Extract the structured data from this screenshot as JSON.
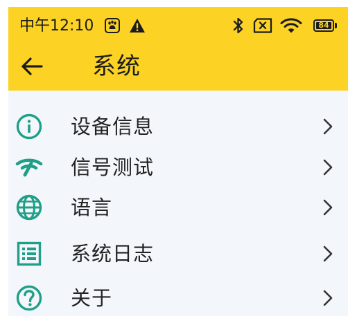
{
  "status_bar": {
    "time": "中午12:10",
    "battery_level": "84",
    "icons": [
      "baidu-paw-icon",
      "warning-icon",
      "bluetooth-icon",
      "no-sim-icon",
      "wifi-icon",
      "battery-icon"
    ]
  },
  "header": {
    "back_icon": "arrow-left-icon",
    "title": "系统"
  },
  "menu": {
    "items": [
      {
        "label": "设备信息",
        "icon": "info-icon"
      },
      {
        "label": "信号测试",
        "icon": "signal-icon"
      },
      {
        "label": "语言",
        "icon": "globe-icon"
      },
      {
        "label": "系统日志",
        "icon": "list-log-icon"
      },
      {
        "label": "关于",
        "icon": "help-circle-icon"
      }
    ],
    "chevron_icon": "chevron-right-icon"
  },
  "colors": {
    "header_background": "#fcd324",
    "accent": "#1f9f87",
    "page_background": "#f3f6fb",
    "text": "#222222"
  }
}
